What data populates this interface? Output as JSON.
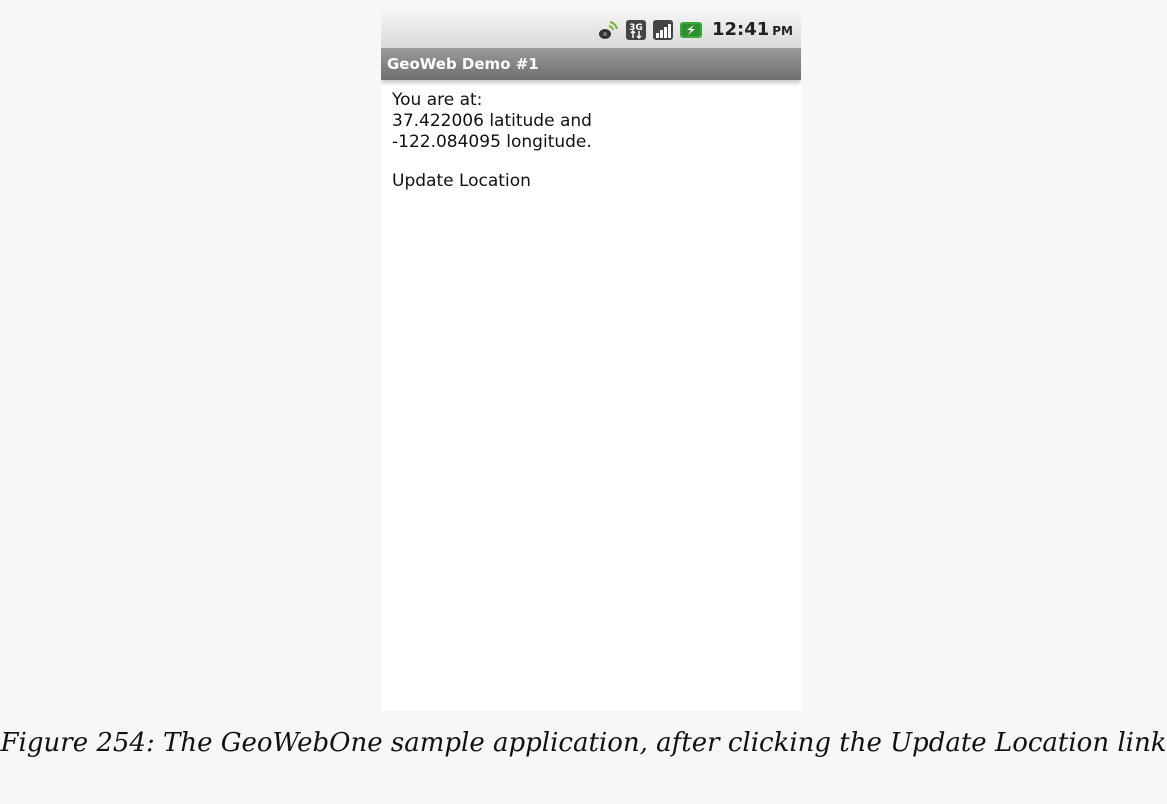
{
  "status_bar": {
    "time": "12:41",
    "time_suffix": "PM",
    "icons": [
      "gps-satellite-icon",
      "3g-data-icon",
      "signal-strength-icon",
      "battery-charging-icon"
    ],
    "network_label": "3G",
    "colors": {
      "gps_green": "#77b82a",
      "battery_green": "#3aa83a"
    }
  },
  "app": {
    "title": "GeoWeb Demo #1"
  },
  "content": {
    "line1": "You are at:",
    "line2": "37.422006 latitude and",
    "line3": "-122.084095 longitude.",
    "update_link": "Update Location"
  },
  "caption": {
    "text": "Figure 254: The GeoWebOne sample application, after clicking the Update Location link"
  }
}
